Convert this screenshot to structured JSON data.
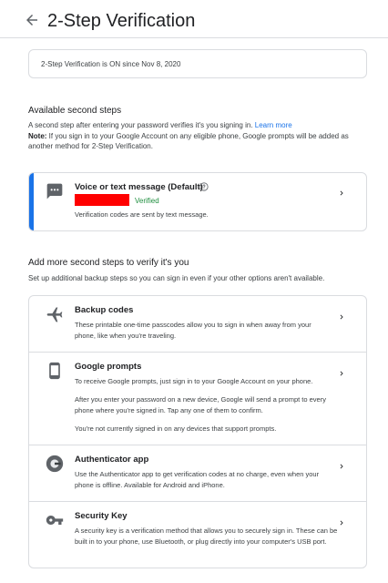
{
  "header": {
    "title": "2-Step Verification"
  },
  "status": {
    "text": "2-Step Verification is ON since Nov 8, 2020"
  },
  "available": {
    "heading": "Available second steps",
    "description": "A second step after entering your password verifies it's you signing in.",
    "learn_more": "Learn more",
    "note_label": "Note:",
    "note_text": " If you sign in to your Google Account on any eligible phone, Google prompts will be added as another method for 2-Step Verification."
  },
  "voice": {
    "title": "Voice or text message (Default)",
    "verified": "Verified",
    "description": "Verification codes are sent by text message.",
    "accent_color": "#1a73e8"
  },
  "more": {
    "heading": "Add more second steps to verify it's you",
    "description": "Set up additional backup steps so you can sign in even if your other options aren't available."
  },
  "options": [
    {
      "title": "Backup codes",
      "icon": "airplane-icon",
      "desc": [
        "These printable one-time passcodes allow you to sign in when away from your phone, like when you're traveling."
      ]
    },
    {
      "title": "Google prompts",
      "icon": "phone-icon",
      "desc": [
        "To receive Google prompts, just sign in to your Google Account on your phone.",
        "After you enter your password on a new device, Google will send a prompt to every phone where you're signed in. Tap any one of them to confirm.",
        "You're not currently signed in on any devices that support prompts."
      ]
    },
    {
      "title": "Authenticator app",
      "icon": "authenticator-icon",
      "desc": [
        "Use the Authenticator app to get verification codes at no charge, even when your phone is offline. Available for Android and iPhone."
      ]
    },
    {
      "title": "Security Key",
      "icon": "key-icon",
      "desc": [
        "A security key is a verification method that allows you to securely sign in. These can be built in to your phone, use Bluetooth, or plug directly into your computer's USB port."
      ]
    }
  ]
}
